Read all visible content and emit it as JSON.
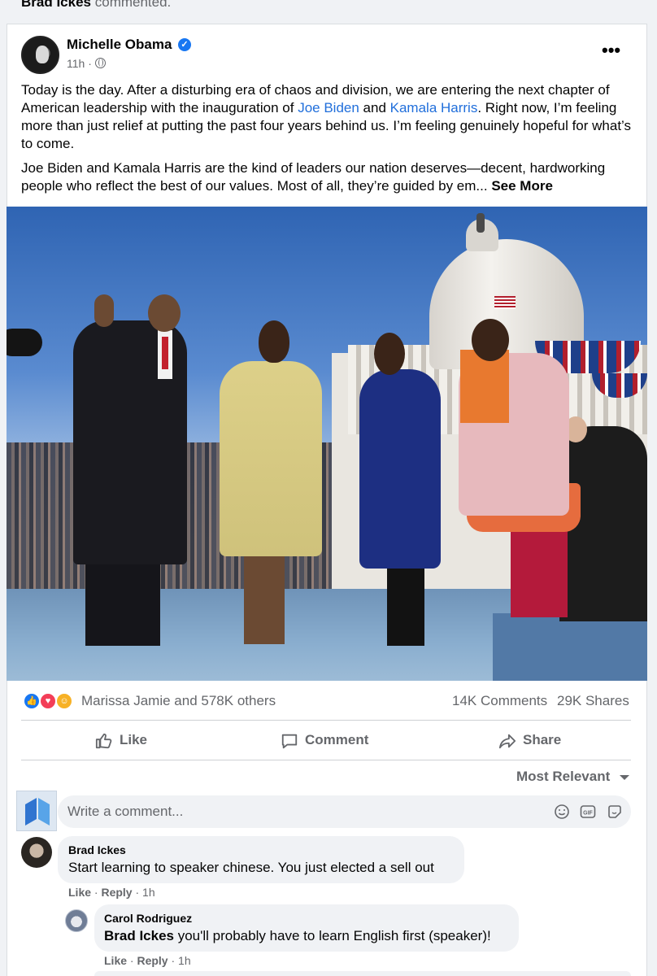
{
  "previous_notice": {
    "name": "Brad Ickes",
    "text": "commented."
  },
  "post": {
    "author": "Michelle Obama",
    "verified_glyph": "✓",
    "time": "11h",
    "separator": "·",
    "audience_icon": "globe-icon",
    "menu_glyph": "•••",
    "paragraph1": {
      "text_a": "Today is the day. After a disturbing era of chaos and division, we are entering the next chapter of American leadership with the inauguration of ",
      "link1": "Joe Biden",
      "text_b": " and ",
      "link2": "Kamala Harris",
      "text_c": ". Right now, I’m feeling more than just relief at putting the past four years behind us. I’m feeling genuinely hopeful for what’s to come."
    },
    "paragraph2": {
      "text": "Joe Biden and Kamala Harris are the kind of leaders our nation deserves—decent, hardworking people who reflect the best of our values. Most of all, they’re guided by em... ",
      "see_more": "See More"
    }
  },
  "stats": {
    "reactions": [
      "like",
      "love",
      "care"
    ],
    "reaction_text": "Marissa Jamie and 578K others",
    "comments": "14K Comments",
    "shares": "29K Shares"
  },
  "actions": {
    "like": "Like",
    "comment": "Comment",
    "share": "Share"
  },
  "sort": {
    "label": "Most Relevant"
  },
  "composer": {
    "placeholder": "Write a comment...",
    "gif_label": "GIF"
  },
  "comments": [
    {
      "name": "Brad Ickes",
      "text": "Start learning to speaker chinese. You just elected a sell out",
      "like": "Like",
      "reply": "Reply",
      "dot": "·",
      "time": "1h"
    },
    {
      "name": "Carol Rodriguez",
      "mention": "Brad Ickes",
      "text": " you'll probably have to learn English first (speaker)!",
      "like": "Like",
      "reply": "Reply",
      "dot": "·",
      "time": "1h"
    }
  ],
  "colors": {
    "accent": "#1877f2",
    "link": "#216fdb",
    "secondary_text": "#65676b",
    "bubble": "#f0f2f5"
  }
}
